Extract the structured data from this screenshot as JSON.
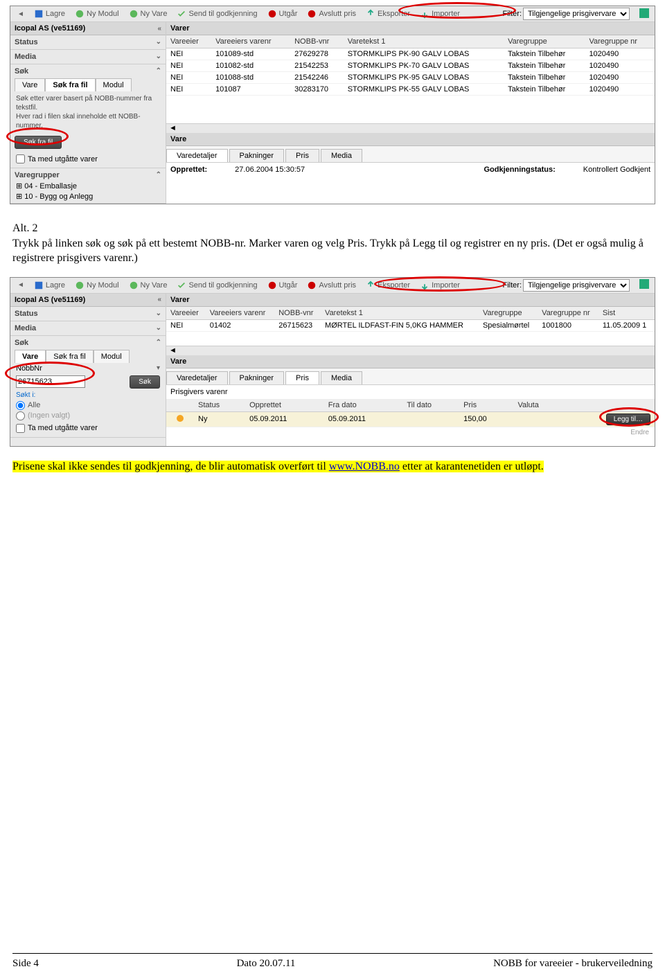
{
  "toolbar": {
    "lagre": "Lagre",
    "ny_modul": "Ny Modul",
    "ny_vare": "Ny Vare",
    "send_godkj": "Send til godkjenning",
    "utgar": "Utgår",
    "avslutt_pris": "Avslutt pris",
    "eksporter": "Eksporter",
    "importer": "Importer",
    "filter_label": "Filter:",
    "filter_value": "Tilgjengelige prisgivervare"
  },
  "sidebar1": {
    "company": "Icopal AS (ve51169)",
    "status": "Status",
    "media": "Media",
    "sok": "Søk",
    "tabs": {
      "vare": "Vare",
      "sok_fil": "Søk fra fil",
      "modul": "Modul"
    },
    "help1": "Søk etter varer basert på NOBB-nummer fra tekstfil.",
    "help2": "Hver rad i filen skal inneholde ett NOBB-nummer.",
    "btn_sok_fil": "Søk fra fil",
    "chk_utgatte": "Ta med utgåtte varer",
    "varegrupper": "Varegrupper",
    "tree1": "04 - Emballasje",
    "tree2": "10 - Bygg og Anlegg"
  },
  "grid1": {
    "title": "Varer",
    "cols": [
      "Vareeier",
      "Vareeiers varenr",
      "NOBB-vnr",
      "Varetekst 1",
      "Varegruppe",
      "Varegruppe nr"
    ],
    "rows": [
      [
        "NEI",
        "101089-std",
        "27629278",
        "STORMKLIPS PK-90 GALV LOBAS",
        "Takstein Tilbehør",
        "1020490"
      ],
      [
        "NEI",
        "101082-std",
        "21542253",
        "STORMKLIPS PK-70 GALV LOBAS",
        "Takstein Tilbehør",
        "1020490"
      ],
      [
        "NEI",
        "101088-std",
        "21542246",
        "STORMKLIPS PK-95 GALV LOBAS",
        "Takstein Tilbehør",
        "1020490"
      ],
      [
        "NEI",
        "101087",
        "30283170",
        "STORMKLIPS PK-55 GALV LOBAS",
        "Takstein Tilbehør",
        "1020490"
      ]
    ]
  },
  "detail1": {
    "vare": "Vare",
    "tabs": {
      "varedetaljer": "Varedetaljer",
      "pakninger": "Pakninger",
      "pris": "Pris",
      "media": "Media"
    },
    "opprettet_lbl": "Opprettet:",
    "opprettet_val": "27.06.2004 15:30:57",
    "godkj_lbl": "Godkjenningstatus:",
    "godkj_val": "Kontrollert Godkjent"
  },
  "bodytext": {
    "alt2_title": "Alt. 2",
    "alt2_p": "Trykk på linken søk og søk på ett bestemt NOBB-nr. Marker varen og velg Pris. Trykk på Legg til og registrer en ny pris. (Det er også mulig å registrere prisgivers varenr.)"
  },
  "sidebar2": {
    "company": "Icopal AS (ve51169)",
    "status": "Status",
    "media": "Media",
    "sok": "Søk",
    "tabs": {
      "vare": "Vare",
      "sok_fil": "Søk fra fil",
      "modul": "Modul"
    },
    "nobbnr_label": "NobbNr",
    "nobbnr_value": "26715623",
    "btn_sok": "Søk",
    "sokt_i": "Søkt i:",
    "alle": "Alle",
    "ingen": "(Ingen valgt)",
    "chk_utgatte": "Ta med utgåtte varer"
  },
  "grid2": {
    "title": "Varer",
    "cols": [
      "Vareeier",
      "Vareeiers varenr",
      "NOBB-vnr",
      "Varetekst 1",
      "Varegruppe",
      "Varegruppe nr",
      "Sist"
    ],
    "rows": [
      [
        "NEI",
        "01402",
        "26715623",
        "MØRTEL ILDFAST-FIN 5,0KG HAMMER",
        "Spesialmørtel",
        "1001800",
        "11.05.2009 1"
      ]
    ]
  },
  "detail2": {
    "vare": "Vare",
    "tabs": {
      "varedetaljer": "Varedetaljer",
      "pakninger": "Pakninger",
      "pris": "Pris",
      "media": "Media"
    },
    "prisgivers": "Prisgivers varenr",
    "pris_cols": [
      "",
      "Status",
      "Opprettet",
      "Fra dato",
      "Til dato",
      "Pris",
      "Valuta"
    ],
    "pris_row": {
      "status": "Ny",
      "opprettet": "05.09.2011",
      "fra": "05.09.2011",
      "til": "",
      "pris": "150,00",
      "valuta": ""
    },
    "legg_til": "Legg til…",
    "endre": "Endre"
  },
  "highlight": {
    "p1a": "Prisene skal ikke sendes til godkjenning, de blir automatisk overført til ",
    "link": "www.NOBB.no",
    "p1b": " etter at karantenetiden er utløpt."
  },
  "footer": {
    "left": "Side 4",
    "center": "Dato 20.07.11",
    "right": "NOBB for vareeier - brukerveiledning"
  }
}
